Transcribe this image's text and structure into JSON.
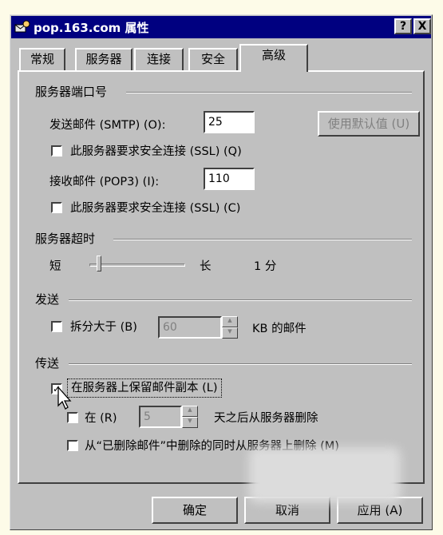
{
  "window": {
    "title": "pop.163.com 属性",
    "help_glyph": "?",
    "close_glyph": "X"
  },
  "tabs": [
    {
      "label": "常规"
    },
    {
      "label": "服务器"
    },
    {
      "label": "连接"
    },
    {
      "label": "安全"
    },
    {
      "label": "高级"
    }
  ],
  "active_tab": "高级",
  "ports": {
    "group_label": "服务器端口号",
    "smtp_label": "发送邮件 (SMTP) (O):",
    "smtp_value": "25",
    "default_button": "使用默认值 (U)",
    "smtp_ssl_label": "此服务器要求安全连接 (SSL) (Q)",
    "pop3_label": "接收邮件 (POP3) (I):",
    "pop3_value": "110",
    "pop3_ssl_label": "此服务器要求安全连接 (SSL) (C)"
  },
  "timeout": {
    "group_label": "服务器超时",
    "short_label": "短",
    "long_label": "长",
    "value_text": "1 分",
    "slider_level": 0.1
  },
  "send": {
    "group_label": "发送",
    "split_label": "拆分大于 (B)",
    "split_value": "60",
    "split_unit": "KB 的邮件"
  },
  "delivery": {
    "group_label": "传送",
    "keep_copy_label": "在服务器上保留邮件副本 (L)",
    "keep_copy_checked": true,
    "remove_after_label": "在 (R)",
    "remove_after_value": "5",
    "remove_after_suffix": "天之后从服务器删除",
    "remove_deleted_label": "从“已删除邮件”中删除的同时从服务器上删除 (M)"
  },
  "buttons": {
    "ok": "确定",
    "cancel": "取消",
    "apply": "应用 (A)"
  },
  "check_glyph": "✓",
  "icons": {
    "title": "mail-account-icon",
    "spin": "spin-arrows-icon",
    "cursor": "arrow-cursor-icon"
  }
}
